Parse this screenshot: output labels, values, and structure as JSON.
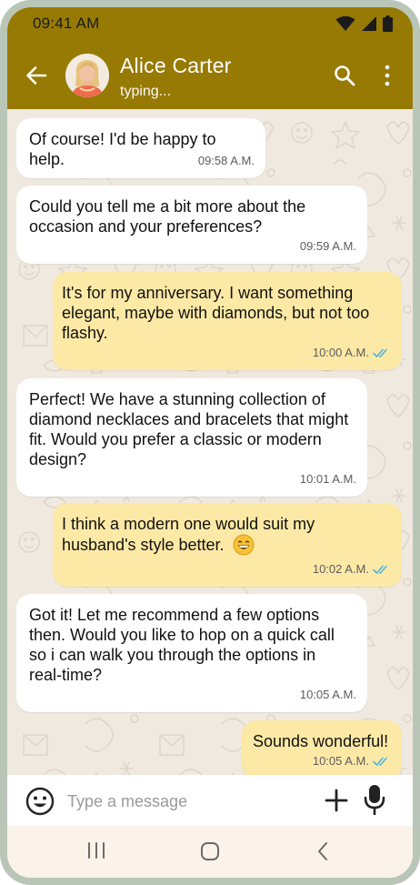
{
  "status_bar": {
    "time": "09:41 AM",
    "icons": [
      "wifi-icon",
      "cellular-signal-icon",
      "battery-icon"
    ]
  },
  "header": {
    "contact_name": "Alice Carter",
    "contact_status": "typing...",
    "icons": [
      "back-arrow-icon",
      "search-icon",
      "more-vertical-icon"
    ]
  },
  "messages": [
    {
      "direction": "incoming",
      "text": "Of course! I'd be happy to help.",
      "time": "09:58 A.M."
    },
    {
      "direction": "incoming",
      "text": "Could you tell me a bit more about the occasion and your preferences?",
      "time": "09:59 A.M."
    },
    {
      "direction": "outgoing",
      "text": "It's for my anniversary. I want something elegant, maybe with diamonds, but not too flashy.",
      "time": "10:00 A.M.",
      "read": true
    },
    {
      "direction": "incoming",
      "text": "Perfect! We have a stunning collection of diamond necklaces and bracelets that might fit. Would you prefer a classic or modern design?",
      "time": "10:01 A.M."
    },
    {
      "direction": "outgoing",
      "text": "I think a modern one would suit my husband's style better.",
      "emoji": "grinning-face-emoji",
      "time": "10:02 A.M.",
      "read": true
    },
    {
      "direction": "incoming",
      "text": "Got it! Let me recommend a few options then. Would you like to hop on a quick call so i can walk you through the options in real-time?",
      "time": "10:05 A.M."
    },
    {
      "direction": "outgoing",
      "text": "Sounds wonderful!",
      "time": "10:05 A.M.",
      "read": true
    }
  ],
  "input_bar": {
    "placeholder": "Type a message",
    "value": "",
    "icons": [
      "emoji-icon",
      "plus-icon",
      "microphone-icon"
    ]
  },
  "nav_bar": {
    "icons": [
      "recent-apps-icon",
      "home-icon",
      "back-icon"
    ]
  },
  "colors": {
    "header": "#967a04",
    "outgoing_bubble": "#fde9a6",
    "incoming_bubble": "#ffffff",
    "chat_background": "#efe9df",
    "read_ticks": "#4fb3e0"
  }
}
